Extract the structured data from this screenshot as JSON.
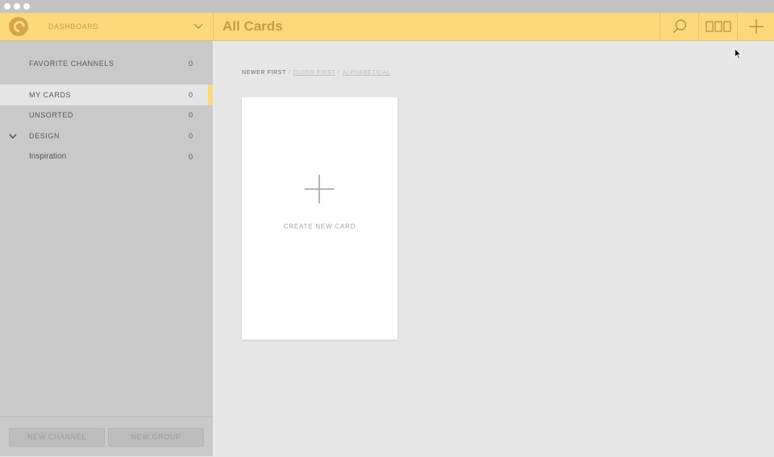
{
  "header": {
    "section": "DASHBOARD",
    "title": "All Cards"
  },
  "sidebar": {
    "favorites": {
      "label": "FAVORITE CHANNELS",
      "count": "0"
    },
    "items": [
      {
        "label": "MY CARDS",
        "count": "0"
      },
      {
        "label": "UNSORTED",
        "count": "0"
      },
      {
        "label": "DESIGN",
        "count": "0"
      },
      {
        "label": "Inspiration",
        "count": "0"
      }
    ],
    "new_channel": "NEW CHANNEL",
    "new_group": "NEW GROUP"
  },
  "sort": {
    "active": "NEWER FIRST",
    "options": [
      "OLDER FIRST",
      "ALPHABETICAL"
    ],
    "separator": "/"
  },
  "card": {
    "label": "CREATE NEW CARD"
  },
  "icons": {
    "logo": "c-logo-icon",
    "dropdown": "chevron-down-icon",
    "search": "search-icon",
    "view": "grid-view-icon",
    "add": "plus-icon",
    "cursor": "mouse-cursor-icon"
  },
  "colors": {
    "accent": "#fdd97c",
    "accent_text": "#c49c43",
    "sidebar_bg": "#c9c9c9",
    "main_bg": "#e7e7e7"
  }
}
